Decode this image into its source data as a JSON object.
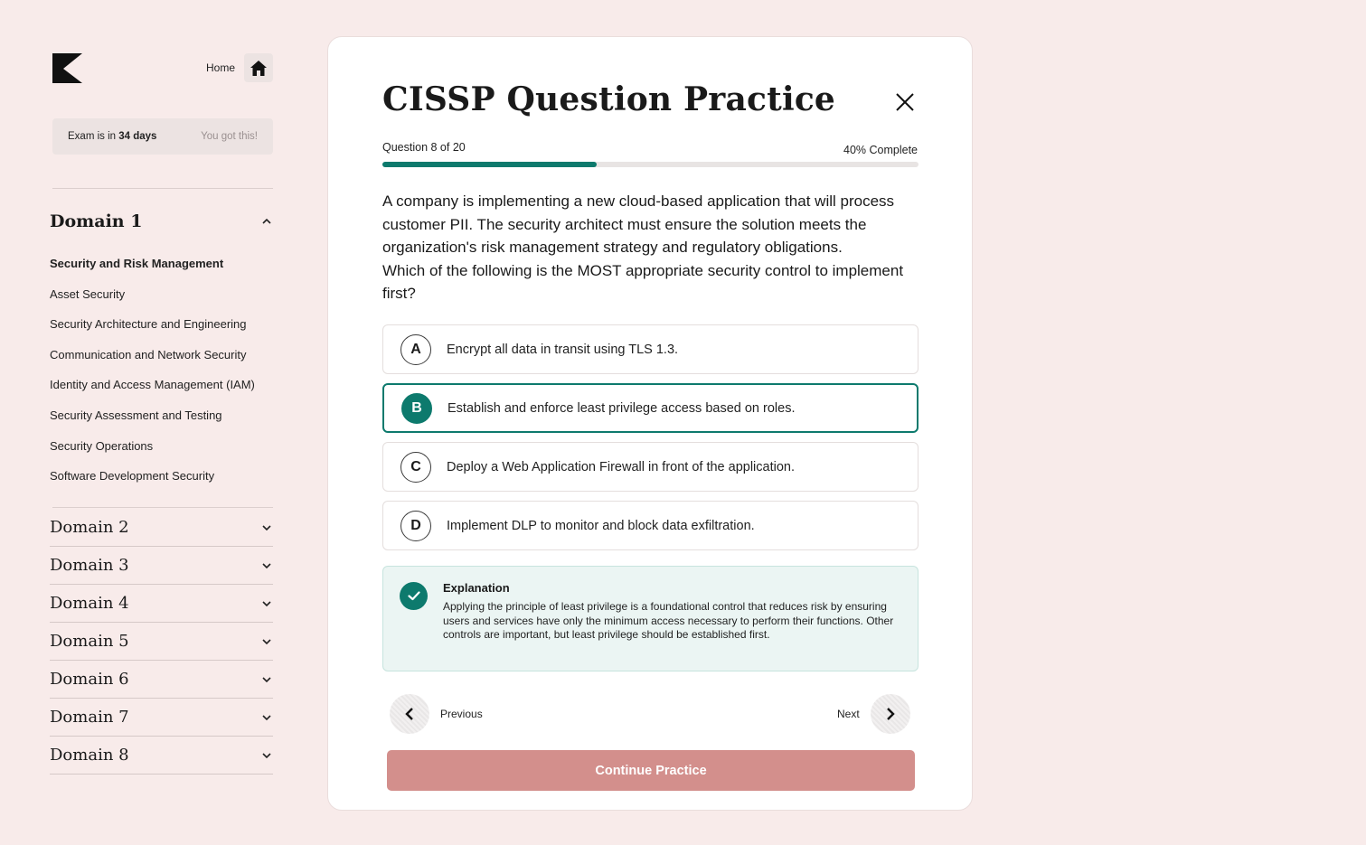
{
  "sidebar": {
    "home_label": "Home",
    "exam_prefix": "Exam is in ",
    "exam_days": "34 days",
    "exam_encourage": "You got this!",
    "domain1": {
      "title": "Domain 1",
      "items": [
        "Security and Risk Management",
        "Asset Security",
        "Security Architecture and Engineering",
        "Communication and Network Security",
        "Identity and Access Management (IAM)",
        "Security Assessment and Testing",
        "Security Operations",
        "Software Development Security"
      ]
    },
    "domains": [
      "Domain 2",
      "Domain 3",
      "Domain 4",
      "Domain 5",
      "Domain 6",
      "Domain 7",
      "Domain 8"
    ]
  },
  "card": {
    "title": "CISSP Question Practice",
    "question_count": "Question 8 of 20",
    "complete_label": "40% Complete",
    "progress": 0.4,
    "question_line1": "A company is implementing a new cloud-based application that will process customer PII. The security architect must ensure the solution meets the organization's risk management strategy and regulatory obligations.",
    "question_line2": "Which of the following is the MOST appropriate security control to implement first?",
    "options": [
      {
        "letter": "A",
        "text": "Encrypt all data in transit using TLS 1.3."
      },
      {
        "letter": "B",
        "text": "Establish and enforce least privilege access based on roles."
      },
      {
        "letter": "C",
        "text": "Deploy a Web Application Firewall in front of the application."
      },
      {
        "letter": "D",
        "text": "Implement DLP to monitor and block data exfiltration."
      }
    ],
    "explanation_title": "Explanation",
    "explanation_body": "Applying the principle of least privilege is a foundational control that reduces risk by ensuring users and services have only the minimum access necessary to perform their functions. Other controls are important, but least privilege should be established first.",
    "previous_label": "Previous",
    "next_label": "Next",
    "continue_label": "Continue Practice"
  },
  "colors": {
    "accent": "#0d7a6d",
    "cta": "#d38f8c",
    "background": "#f8ebea"
  }
}
